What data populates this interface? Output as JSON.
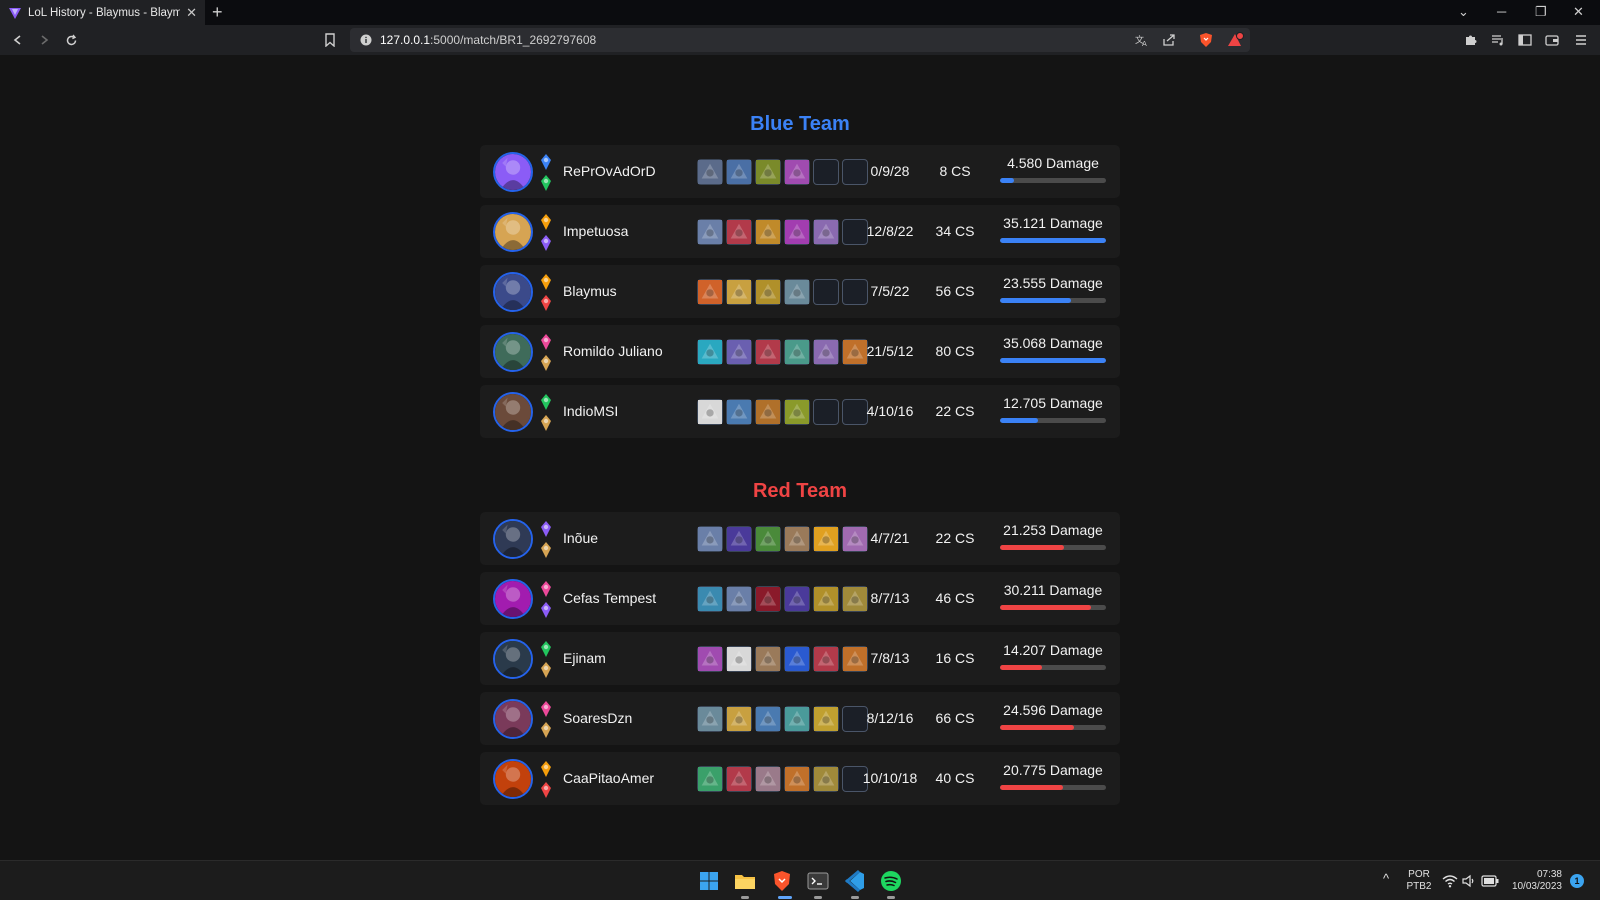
{
  "browser": {
    "tab_title": "LoL History - Blaymus - Blaymus",
    "tab_close": "✕",
    "new_tab": "+",
    "url_host": "127.0.0.1",
    "url_rest": ":5000/match/BR1_2692797608",
    "window_controls": {
      "minimize": "─",
      "restore": "❐",
      "close": "✕",
      "tab_list": "⌄"
    },
    "notification_badge_color": "#ef4444"
  },
  "colors": {
    "blue": "#3b82f6",
    "red": "#ef4444",
    "row_bg": "#1c1c1c",
    "page_bg": "#141414"
  },
  "match": {
    "blue_team": {
      "title": "Blue Team",
      "players": [
        {
          "name": "RePrOvAdOrD",
          "kda": "0/9/28",
          "cs": "8 CS",
          "damage": "4.580 Damage",
          "damage_fraction": 0.13,
          "items_filled": 4,
          "champ_color": "#8b5cf6",
          "rune_primary": "#3b82f6",
          "rune_secondary": "#22c55e",
          "item_colors": [
            "#5b6b8a",
            "#4a6fa5",
            "#7a8a2a",
            "#a04bb0"
          ]
        },
        {
          "name": "Impetuosa",
          "kda": "12/8/22",
          "cs": "34 CS",
          "damage": "35.121 Damage",
          "damage_fraction": 1.0,
          "items_filled": 5,
          "champ_color": "#d6a453",
          "rune_primary": "#f59e0b",
          "rune_secondary": "#8b5cf6",
          "item_colors": [
            "#6a7fa8",
            "#b23a4a",
            "#c08a2a",
            "#a23db0",
            "#8a6ab0"
          ]
        },
        {
          "name": "Blaymus",
          "kda": "7/5/22",
          "cs": "56 CS",
          "damage": "23.555 Damage",
          "damage_fraction": 0.67,
          "items_filled": 4,
          "champ_color": "#3b4a8a",
          "rune_primary": "#f59e0b",
          "rune_secondary": "#ef4444",
          "item_colors": [
            "#d0622a",
            "#c8a040",
            "#b0902a",
            "#6a8a9a"
          ]
        },
        {
          "name": "Romildo Juliano",
          "kda": "21/5/12",
          "cs": "80 CS",
          "damage": "35.068 Damage",
          "damage_fraction": 1.0,
          "items_filled": 6,
          "champ_color": "#3f6b5a",
          "rune_primary": "#ec4899",
          "rune_secondary": "#d6a453",
          "item_colors": [
            "#2aa8c0",
            "#6a5fb0",
            "#b23a4a",
            "#4a9a8a",
            "#8a6ab0",
            "#c0702a"
          ]
        },
        {
          "name": "IndioMSI",
          "kda": "4/10/16",
          "cs": "22 CS",
          "damage": "12.705 Damage",
          "damage_fraction": 0.36,
          "items_filled": 4,
          "champ_color": "#6b4a3a",
          "rune_primary": "#22c55e",
          "rune_secondary": "#d6a453",
          "item_colors": [
            "#d8d8d8",
            "#4a7ab0",
            "#b0702a",
            "#8a9a2a"
          ]
        }
      ]
    },
    "red_team": {
      "title": "Red Team",
      "players": [
        {
          "name": "Inõue",
          "kda": "4/7/21",
          "cs": "22 CS",
          "damage": "21.253 Damage",
          "damage_fraction": 0.6,
          "items_filled": 6,
          "champ_color": "#2f3a55",
          "rune_primary": "#8b5cf6",
          "rune_secondary": "#d6a453",
          "item_colors": [
            "#6a7fa8",
            "#4a3a9a",
            "#4a8a3a",
            "#9a7a5a",
            "#e0a020",
            "#a06ab0"
          ]
        },
        {
          "name": "Cefas Tempest",
          "kda": "8/7/13",
          "cs": "46 CS",
          "damage": "30.211 Damage",
          "damage_fraction": 0.86,
          "items_filled": 6,
          "champ_color": "#a21caf",
          "rune_primary": "#ec4899",
          "rune_secondary": "#8b5cf6",
          "item_colors": [
            "#3a8ab0",
            "#6a7fa8",
            "#8a1a2a",
            "#4a3a9a",
            "#b0902a",
            "#a08a3a"
          ]
        },
        {
          "name": "Ejinam",
          "kda": "7/8/13",
          "cs": "16 CS",
          "damage": "14.207 Damage",
          "damage_fraction": 0.4,
          "items_filled": 6,
          "champ_color": "#2a3a4a",
          "rune_primary": "#22c55e",
          "rune_secondary": "#d6a453",
          "item_colors": [
            "#a04bb0",
            "#d8d8d8",
            "#9a7a5a",
            "#2a5ad0",
            "#b23a4a",
            "#c0702a"
          ]
        },
        {
          "name": "SoaresDzn",
          "kda": "8/12/16",
          "cs": "66 CS",
          "damage": "24.596 Damage",
          "damage_fraction": 0.7,
          "items_filled": 5,
          "champ_color": "#7a3a5a",
          "rune_primary": "#ec4899",
          "rune_secondary": "#d6a453",
          "item_colors": [
            "#6a8a9a",
            "#c8a040",
            "#4a7ab0",
            "#4a9a9a",
            "#c0a030"
          ]
        },
        {
          "name": "CaaPitaoAmer",
          "kda": "10/10/18",
          "cs": "40 CS",
          "damage": "20.775 Damage",
          "damage_fraction": 0.59,
          "items_filled": 5,
          "champ_color": "#c2410c",
          "rune_primary": "#f59e0b",
          "rune_secondary": "#ef4444",
          "item_colors": [
            "#3aa06a",
            "#b23a4a",
            "#9a7a8a",
            "#c0702a",
            "#a08a3a"
          ]
        }
      ]
    }
  },
  "taskbar": {
    "lang_top": "POR",
    "lang_bottom": "PTB2",
    "time": "07:38",
    "date": "10/03/2023",
    "notification_count": "1",
    "tray_chevron": "^"
  }
}
